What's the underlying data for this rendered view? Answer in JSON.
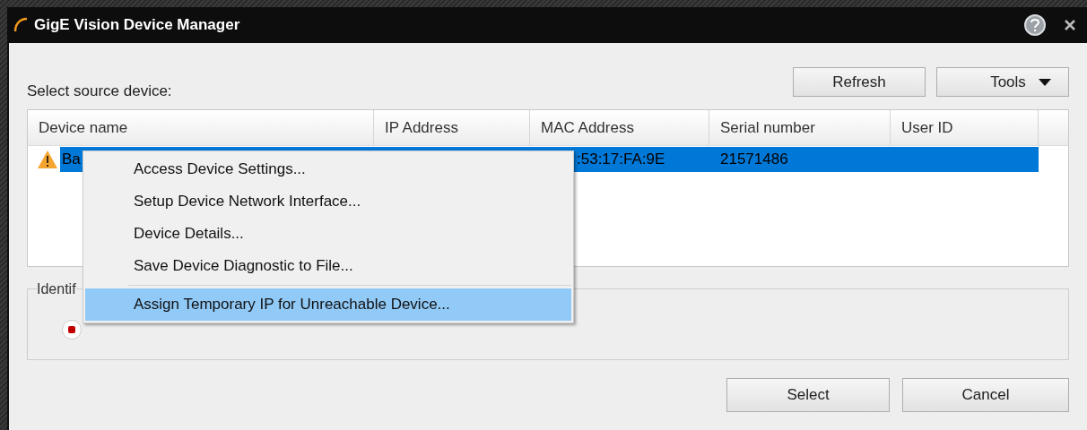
{
  "window": {
    "title": "GigE Vision Device Manager"
  },
  "label": "Select source device:",
  "toolbar": [
    {
      "label": "Refresh",
      "kind": "plain"
    },
    {
      "label": "Tools",
      "kind": "dropdown"
    }
  ],
  "table": {
    "columns": [
      "Device name",
      "IP Address",
      "MAC Address",
      "Serial number",
      "User ID"
    ],
    "rows": [
      {
        "selected": true,
        "warning": true,
        "cells": [
          "Ba",
          "",
          ":53:17:FA:9E",
          "21571486",
          ""
        ]
      }
    ]
  },
  "group": {
    "legend": "Identif",
    "indicator": {
      "on": true
    }
  },
  "context_menu": [
    {
      "label": "Access Device Settings...",
      "selected": false,
      "separator_before": false
    },
    {
      "label": "Setup Device Network Interface...",
      "selected": false,
      "separator_before": false
    },
    {
      "label": "Device Details...",
      "selected": false,
      "separator_before": false
    },
    {
      "label": "Save Device Diagnostic to File...",
      "selected": false,
      "separator_before": false
    },
    {
      "label": "Assign Temporary IP for Unreachable Device...",
      "selected": true,
      "separator_before": true
    }
  ],
  "buttons": [
    "Select",
    "Cancel"
  ]
}
